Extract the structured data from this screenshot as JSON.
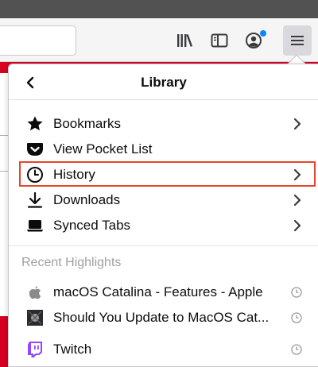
{
  "browser": {
    "accent": "#0a84ff"
  },
  "panel": {
    "title": "Library",
    "items": [
      {
        "label": "Bookmarks",
        "icon": "star-icon",
        "has_submenu": true
      },
      {
        "label": "View Pocket List",
        "icon": "pocket-icon",
        "has_submenu": false
      },
      {
        "label": "History",
        "icon": "clock-icon",
        "has_submenu": true,
        "highlighted": true,
        "highlight_color": "#e8452b"
      },
      {
        "label": "Downloads",
        "icon": "download-icon",
        "has_submenu": true
      },
      {
        "label": "Synced Tabs",
        "icon": "laptop-icon",
        "has_submenu": true
      }
    ],
    "recent": {
      "title": "Recent Highlights",
      "items": [
        {
          "label": "macOS Catalina - Features - Apple",
          "icon": "apple-icon"
        },
        {
          "label": "Should You Update to MacOS Cat...",
          "icon": "site-thumbnail-icon"
        },
        {
          "label": "Twitch",
          "icon": "twitch-icon"
        }
      ]
    }
  }
}
